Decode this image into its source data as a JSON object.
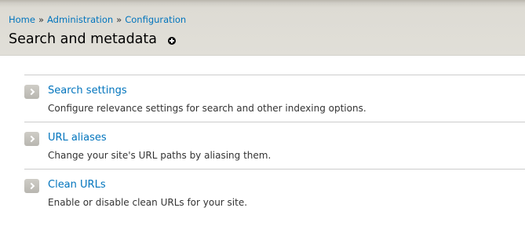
{
  "breadcrumb": {
    "items": [
      "Home",
      "Administration",
      "Configuration"
    ],
    "separator": "»"
  },
  "page": {
    "title": "Search and metadata",
    "shortcut_icon": "plus-circle-icon"
  },
  "admin_list": [
    {
      "title": "Search settings",
      "description": "Configure relevance settings for search and other indexing options.",
      "icon": "chevron-right-icon"
    },
    {
      "title": "URL aliases",
      "description": "Change your site's URL paths by aliasing them.",
      "icon": "chevron-right-icon"
    },
    {
      "title": "Clean URLs",
      "description": "Enable or disable clean URLs for your site.",
      "icon": "chevron-right-icon"
    }
  ],
  "colors": {
    "link": "#0074bd",
    "header_bg": "#e1dfd8",
    "text": "#333333"
  }
}
